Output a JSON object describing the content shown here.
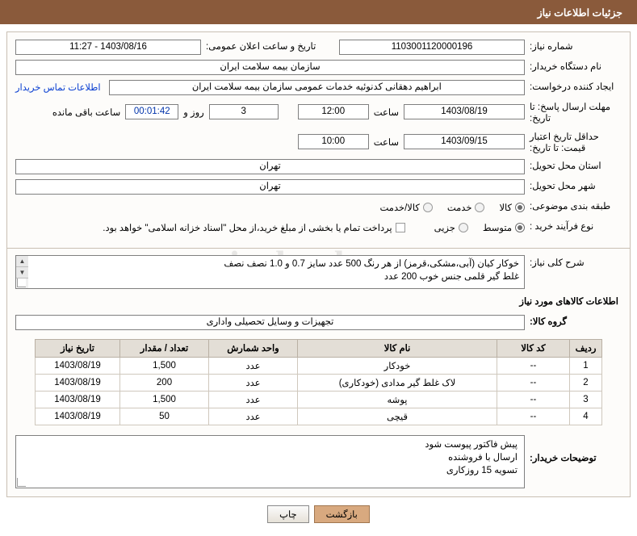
{
  "header": {
    "title": "جزئیات اطلاعات نیاز"
  },
  "form": {
    "need_number_label": "شماره نیاز:",
    "need_number_value": "1103001120000196",
    "announce_date_label": "تاریخ و ساعت اعلان عمومی:",
    "announce_date_value": "1403/08/16 - 11:27",
    "buyer_org_label": "نام دستگاه خریدار:",
    "buyer_org_value": "سازمان بیمه سلامت ایران",
    "requester_label": "ایجاد کننده درخواست:",
    "requester_value": "ابراهیم دهقانی کدنوئیه خدمات عمومی سازمان بیمه سلامت ایران",
    "contact_link": "اطلاعات تماس خریدار",
    "deadline_label": "مهلت ارسال پاسخ: تا تاریخ:",
    "deadline_date": "1403/08/19",
    "hour_label": "ساعت",
    "deadline_time": "12:00",
    "days_value": "3",
    "days_label": "روز و",
    "remaining_timer": "00:01:42",
    "remaining_label": "ساعت باقی مانده",
    "price_valid_label": "حداقل تاریخ اعتبار قیمت: تا تاریخ:",
    "price_valid_date": "1403/09/15",
    "price_valid_hour_label": "ساعت",
    "price_valid_time": "10:00",
    "province_label": "استان محل تحویل:",
    "province_value": "تهران",
    "city_label": "شهر محل تحویل:",
    "city_value": "تهران",
    "subject_label": "طبقه بندی موضوعی:",
    "subject_options": [
      "کالا",
      "خدمت",
      "کالا/خدمت"
    ],
    "subject_selected": "کالا",
    "process_label": "نوع فرآیند خرید :",
    "process_options": [
      "متوسط",
      "جزیی"
    ],
    "process_selected": "متوسط",
    "payment_note": "پرداخت تمام یا بخشی از مبلغ خرید،از محل \"اسناد خزانه اسلامی\" خواهد بود."
  },
  "description": {
    "label": "شرح کلی نیاز:",
    "lines": [
      "خوکار کیان (آبی،مشکی،قرمز) از هر رنگ 500 عدد سایز 0.7 و 1.0 نصف نصف",
      "غلط گیر قلمی جنس خوب 200 عدد"
    ]
  },
  "goods": {
    "section_title": "اطلاعات کالاهای مورد نیاز",
    "group_label": "گروه کالا:",
    "group_value": "تجهیزات و وسایل تحصیلی واداری",
    "columns": [
      "ردیف",
      "کد کالا",
      "نام کالا",
      "واحد شمارش",
      "تعداد / مقدار",
      "تاریخ نیاز"
    ],
    "rows": [
      {
        "index": "1",
        "code": "--",
        "name": "خودکار",
        "unit": "عدد",
        "qty": "1,500",
        "date": "1403/08/19"
      },
      {
        "index": "2",
        "code": "--",
        "name": "لاک غلط گیر مدادی (خودکاری)",
        "unit": "عدد",
        "qty": "200",
        "date": "1403/08/19"
      },
      {
        "index": "3",
        "code": "--",
        "name": "پوشه",
        "unit": "عدد",
        "qty": "1,500",
        "date": "1403/08/19"
      },
      {
        "index": "4",
        "code": "--",
        "name": "قیچی",
        "unit": "عدد",
        "qty": "50",
        "date": "1403/08/19"
      }
    ]
  },
  "buyer_notes": {
    "label": "توضیحات خریدار:",
    "lines": [
      "پیش فاکتور پیوست شود",
      "ارسال با فروشنده",
      "تسویه 15 روزکاری"
    ]
  },
  "footer": {
    "back_button": "بازگشت",
    "print_button": "چاپ"
  },
  "watermark": "aritaleedar.net"
}
